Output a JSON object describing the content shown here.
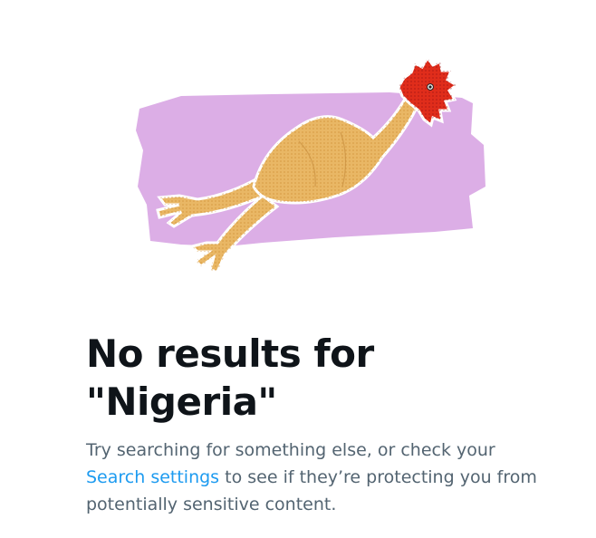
{
  "empty_state": {
    "title_line1": "No results for",
    "title_line2": "\"Nigeria\"",
    "description_before": "Try searching for something else, or check your",
    "settings_link": "Search settings",
    "description_after": " to see if they’re protecting you from potentially sensitive content."
  },
  "colors": {
    "title": "#0f1419",
    "body": "#536471",
    "link": "#1d9bf0",
    "backdrop": "#dcaee6"
  },
  "illustration": {
    "icon": "rubber-chicken-illustration"
  }
}
